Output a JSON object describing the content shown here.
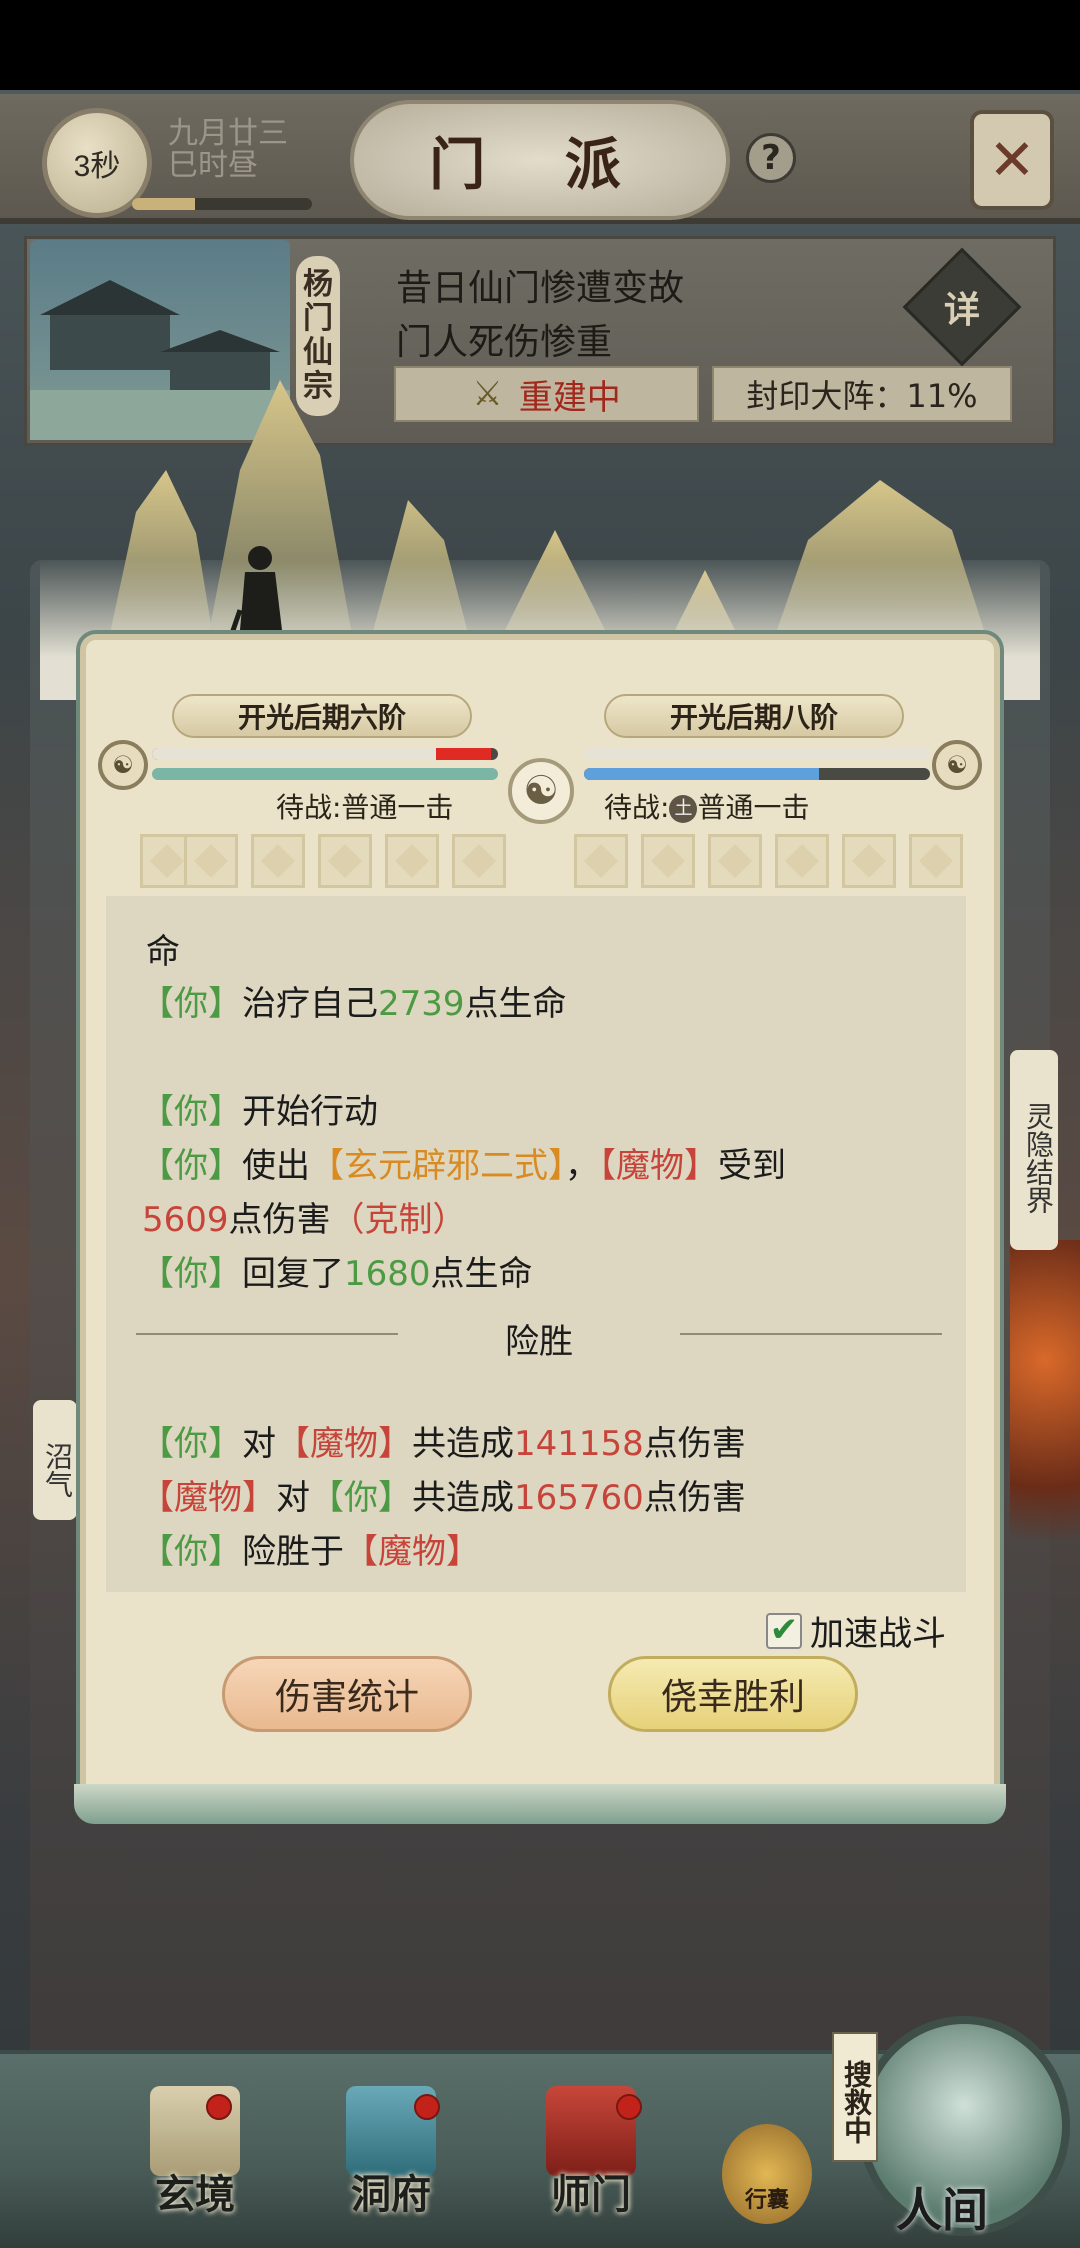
{
  "header": {
    "timer": "3秒",
    "date_line1": "九月廿三",
    "date_line2": "巳时昼",
    "time_progress": 0.35,
    "title": "门 派",
    "help": "?",
    "close": "✕"
  },
  "sect": {
    "name": "杨门仙宗",
    "desc_line1": "昔日仙门惨遭变故",
    "desc_line2": "门人死伤惨重",
    "rebuild": "重建中",
    "seal": "封印大阵：11%",
    "detail": "详"
  },
  "world": {
    "left_tab": "沼气",
    "right_tab": "灵隐结界"
  },
  "battle": {
    "left_rank": "开光后期六阶",
    "right_rank": "开光后期八阶",
    "left_hp": 0.98,
    "left_mp": 1.0,
    "right_hp": 1.0,
    "right_mp": 0.68,
    "left_standby": "待战:普通一击",
    "right_standby_prefix": "待战:",
    "right_standby_badge": "土",
    "right_standby_suffix": "普通一击",
    "log": {
      "l0": "命",
      "l1_a": "【你】",
      "l1_b": "治疗自己",
      "l1_c": "2739",
      "l1_d": "点生命",
      "l2_a": "【你】",
      "l2_b": "开始行动",
      "l3_a": "【你】",
      "l3_b": "使出",
      "l3_c": "【玄元辟邪二式】",
      "l3_d": "，",
      "l3_e": "【魔物】",
      "l3_f": "受到",
      "l4_a": "5609",
      "l4_b": "点伤害",
      "l4_c": "（克制）",
      "l5_a": "【你】",
      "l5_b": "回复了",
      "l5_c": "1680",
      "l5_d": "点生命",
      "divider": "险胜",
      "l6_a": "【你】",
      "l6_b": "对",
      "l6_c": "【魔物】",
      "l6_d": "共造成",
      "l6_e": "141158",
      "l6_f": "点伤害",
      "l7_a": "【魔物】",
      "l7_b": "对",
      "l7_c": "【你】",
      "l7_d": "共造成",
      "l7_e": "165760",
      "l7_f": "点伤害",
      "l8_a": "【你】",
      "l8_b": "险胜于",
      "l8_c": "【魔物】"
    },
    "speed_label": "加速战斗",
    "speed_checked": "✔",
    "btn_stats": "伤害统计",
    "btn_win": "侥幸胜利"
  },
  "nav": {
    "items": [
      "玄境",
      "洞府",
      "师门"
    ],
    "bag": "行囊",
    "search": "搜救中",
    "world": "人间"
  },
  "colors": {
    "heal_green": "#4d9a44",
    "enemy_red": "#c7443a",
    "skill_orange": "#d98b22"
  }
}
